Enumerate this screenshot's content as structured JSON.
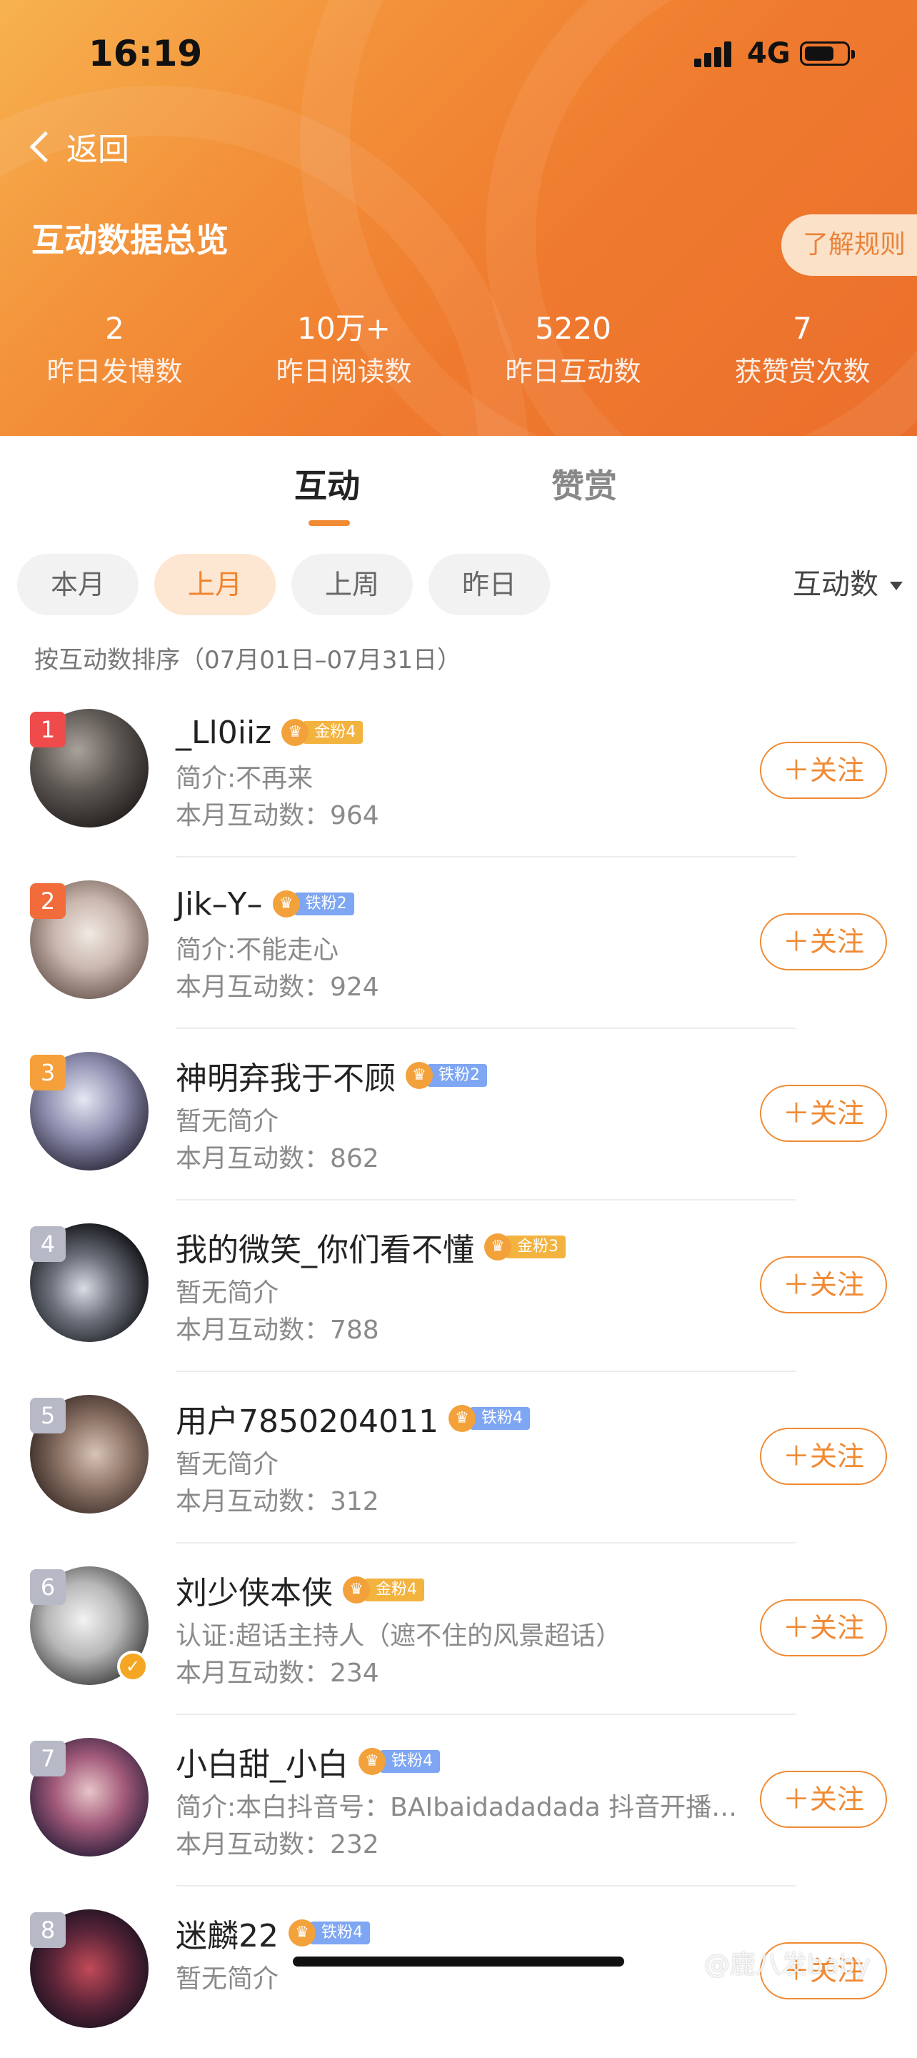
{
  "status_bar": {
    "time": "16:19",
    "network": "4G"
  },
  "nav": {
    "back_label": "返回"
  },
  "header": {
    "title": "互动数据总览",
    "rules_button": "了解规则",
    "stats": [
      {
        "value": "2",
        "label": "昨日发博数"
      },
      {
        "value": "10万+",
        "label": "昨日阅读数"
      },
      {
        "value": "5220",
        "label": "昨日互动数"
      },
      {
        "value": "7",
        "label": "获赞赏次数"
      }
    ]
  },
  "tabs": [
    {
      "label": "互动",
      "active": true
    },
    {
      "label": "赞赏",
      "active": false
    }
  ],
  "filters": {
    "chips": [
      {
        "label": "本月",
        "active": false
      },
      {
        "label": "上月",
        "active": true
      },
      {
        "label": "上周",
        "active": false
      },
      {
        "label": "昨日",
        "active": false
      }
    ],
    "sort_label": "互动数",
    "sort_note": "按互动数排序（07月01日–07月31日）"
  },
  "users": [
    {
      "rank": "1",
      "name": "_Ll0iiz",
      "badge_text": "金粉4",
      "badge_type": "gold",
      "bio": "简介:不再来",
      "count": "本月互动数：964",
      "follow": "＋关注"
    },
    {
      "rank": "2",
      "name": "Jik–Y–",
      "badge_text": "铁粉2",
      "badge_type": "iron",
      "bio": "简介:不能走心",
      "count": "本月互动数：924",
      "follow": "＋关注"
    },
    {
      "rank": "3",
      "name": "神明弃我于不顾",
      "badge_text": "铁粉2",
      "badge_type": "iron",
      "bio": "暂无简介",
      "count": "本月互动数：862",
      "follow": "＋关注"
    },
    {
      "rank": "4",
      "name": "我的微笑_你们看不懂",
      "badge_text": "金粉3",
      "badge_type": "gold",
      "bio": "暂无简介",
      "count": "本月互动数：788",
      "follow": "＋关注"
    },
    {
      "rank": "5",
      "name": "用户7850204011",
      "badge_text": "铁粉4",
      "badge_type": "iron",
      "bio": "暂无简介",
      "count": "本月互动数：312",
      "follow": "＋关注"
    },
    {
      "rank": "6",
      "name": "刘少侠本侠",
      "badge_text": "金粉4",
      "badge_type": "gold",
      "bio": "认证:超话主持人（遮不住的风景超话）",
      "count": "本月互动数：234",
      "follow": "＋关注"
    },
    {
      "rank": "7",
      "name": "小白甜_小白",
      "badge_text": "铁粉4",
      "badge_type": "iron",
      "bio": "简介:本白抖音号：BAIbaidadadada 抖音开播…",
      "count": "本月互动数：232",
      "follow": "＋关注"
    },
    {
      "rank": "8",
      "name": "迷麟22",
      "badge_text": "铁粉4",
      "badge_type": "iron",
      "bio": "暂无简介",
      "count": "",
      "follow": "＋关注"
    }
  ],
  "watermark": "@鹿八发baby",
  "colors": {
    "accent": "#f08a33",
    "rank1": "#ef4b4b",
    "rank2": "#f26b3a",
    "rank3": "#f5a03a",
    "rank_other": "#b7b9c6"
  }
}
